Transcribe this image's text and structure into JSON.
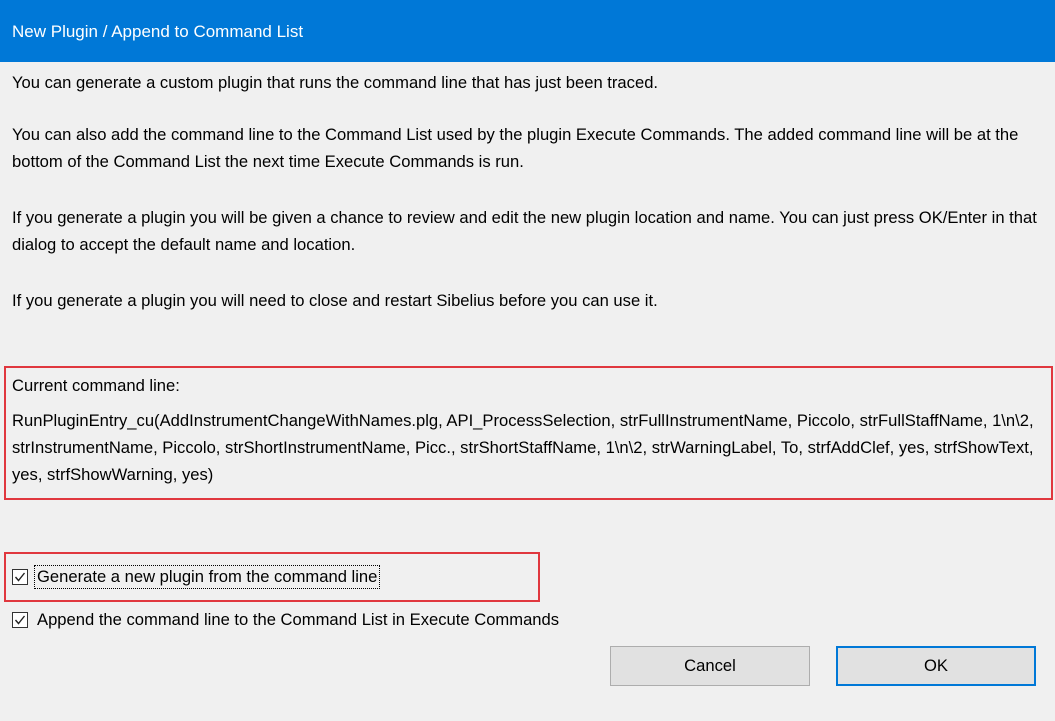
{
  "window": {
    "title": "New Plugin / Append to Command List"
  },
  "paragraphs": {
    "p1": "You can generate a custom plugin that runs the command line that has just been traced.",
    "p2": "You can also add the command line to the Command List used by the plugin Execute Commands. The added command line will be at the bottom of the Command List the next time Execute Commands is run.",
    "p3": "If you generate a plugin you will be given a chance to review and edit the new plugin location and name. You can just press OK/Enter in that dialog to accept the default name and location.",
    "p4": "If you generate a plugin you will need to close and restart Sibelius before you can use it."
  },
  "command": {
    "label": "Current command line:",
    "text": "RunPluginEntry_cu(AddInstrumentChangeWithNames.plg, API_ProcessSelection, strFullInstrumentName, Piccolo, strFullStaffName, 1\\n\\2, strInstrumentName, Piccolo, strShortInstrumentName, Picc., strShortStaffName, 1\\n\\2, strWarningLabel, To, strfAddClef, yes, strfShowText, yes, strfShowWarning, yes)"
  },
  "options": {
    "generate_plugin": {
      "label": "Generate a new plugin from the command line",
      "checked": true
    },
    "append_command": {
      "label": "Append the command line to the Command List in Execute Commands",
      "checked": true
    }
  },
  "buttons": {
    "cancel": "Cancel",
    "ok": "OK"
  },
  "colors": {
    "titlebar": "#0078d7",
    "highlight_border": "#e0373e",
    "dialog_background": "#f0f0f0"
  }
}
